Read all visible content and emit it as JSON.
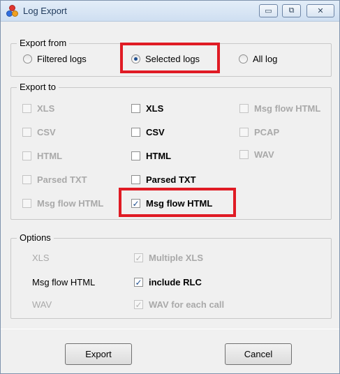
{
  "window": {
    "title": "Log Export"
  },
  "titlebar": {
    "minimize": "▭",
    "restore": "⧉",
    "close": "✕"
  },
  "export_from": {
    "label": "Export from",
    "options": [
      {
        "label": "Filtered logs",
        "selected": false
      },
      {
        "label": "Selected logs",
        "selected": true
      },
      {
        "label": "All log",
        "selected": false
      }
    ]
  },
  "export_to": {
    "label": "Export to",
    "col1": [
      {
        "label": "XLS"
      },
      {
        "label": "CSV"
      },
      {
        "label": "HTML"
      },
      {
        "label": "Parsed TXT"
      },
      {
        "label": "Msg flow HTML"
      }
    ],
    "col2": [
      {
        "label": "XLS",
        "checked": false
      },
      {
        "label": "CSV",
        "checked": false
      },
      {
        "label": "HTML",
        "checked": false
      },
      {
        "label": "Parsed TXT",
        "checked": false
      },
      {
        "label": "Msg flow HTML",
        "checked": true
      }
    ],
    "col3": [
      {
        "label": "Msg flow HTML"
      },
      {
        "label": "PCAP"
      },
      {
        "label": "WAV"
      }
    ]
  },
  "options": {
    "label": "Options",
    "rows": [
      {
        "name": "XLS",
        "check_label": "Multiple XLS",
        "checked": true,
        "enabled": false
      },
      {
        "name": "Msg flow HTML",
        "check_label": "include RLC",
        "checked": true,
        "enabled": true
      },
      {
        "name": "WAV",
        "check_label": "WAV for each call",
        "checked": true,
        "enabled": false
      }
    ]
  },
  "buttons": {
    "export": "Export",
    "cancel": "Cancel"
  },
  "colors": {
    "highlight": "#e01b24",
    "accent": "#1f4f8f"
  },
  "icons": {
    "app": "colored-dots-icon",
    "check": "✓"
  }
}
